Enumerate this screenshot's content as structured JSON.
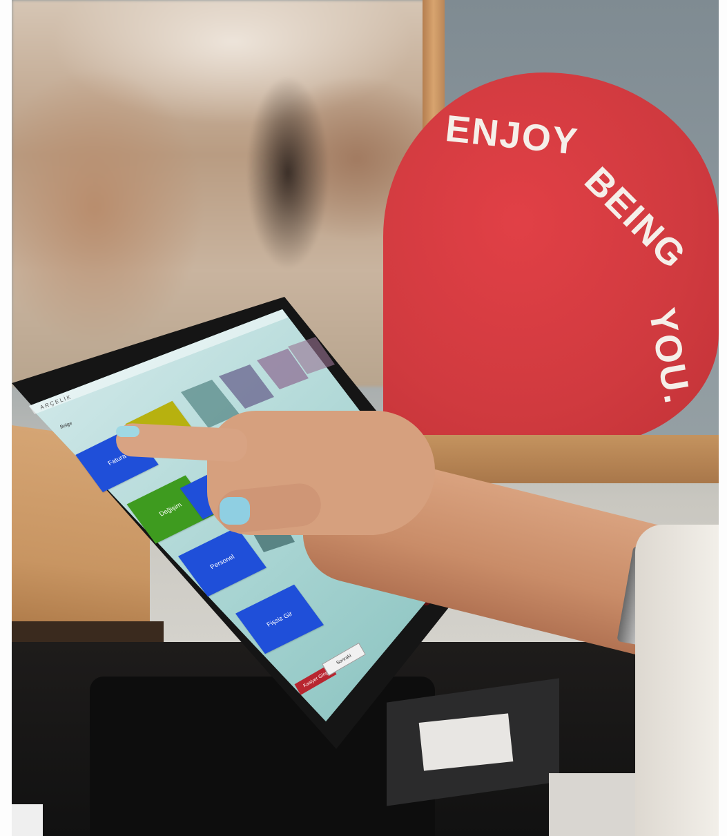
{
  "sign": {
    "text_lines": [
      "ENJOY",
      "BEING",
      "YOU."
    ]
  },
  "pos_screen": {
    "logo": "ARÇELİK",
    "breadcrumb": "Belge",
    "tiles": [
      {
        "label": "Fatura",
        "color": "#1f4fd9"
      },
      {
        "label": "",
        "color": "#b7b10f"
      },
      {
        "label": "Değişim",
        "color": "#3e9b1f"
      },
      {
        "label": "Personel",
        "color": "#1f4fd9"
      },
      {
        "label": "Fişsiz Gir",
        "color": "#1f4fd9"
      }
    ],
    "exit_label": "Kasiyer Giriş",
    "next_label": "Sonraki"
  },
  "colors": {
    "sign_red": "#d03a3f",
    "nail_polish": "#9fd8e4"
  }
}
